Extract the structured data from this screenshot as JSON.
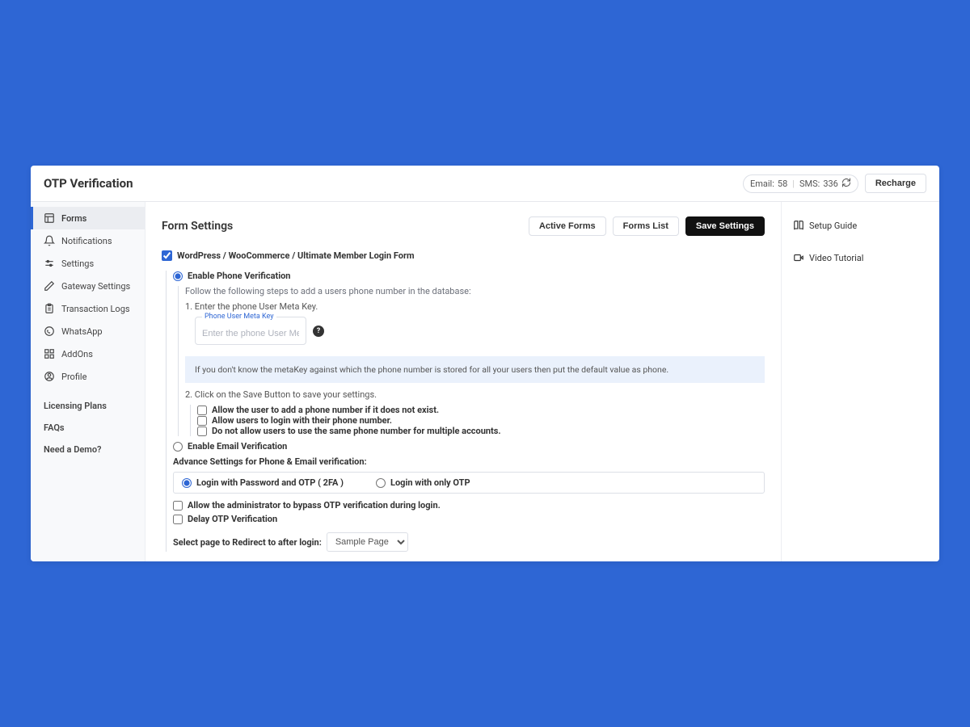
{
  "header": {
    "title": "OTP Verification",
    "quota_email_label": "Email:",
    "quota_email_value": "58",
    "quota_sms_label": "SMS:",
    "quota_sms_value": "336",
    "recharge_label": "Recharge"
  },
  "sidebar": {
    "items": [
      {
        "label": "Forms",
        "icon": "forms-icon",
        "active": true
      },
      {
        "label": "Notifications",
        "icon": "bell-icon"
      },
      {
        "label": "Settings",
        "icon": "sliders-icon"
      },
      {
        "label": "Gateway Settings",
        "icon": "pen-icon"
      },
      {
        "label": "Transaction Logs",
        "icon": "clipboard-icon"
      },
      {
        "label": "WhatsApp",
        "icon": "whatsapp-icon"
      },
      {
        "label": "AddOns",
        "icon": "grid-icon"
      },
      {
        "label": "Profile",
        "icon": "user-icon"
      }
    ],
    "extras": [
      {
        "label": "Licensing Plans"
      },
      {
        "label": "FAQs"
      },
      {
        "label": "Need a Demo?"
      }
    ]
  },
  "content": {
    "title": "Form Settings",
    "buttons": {
      "active_forms": "Active Forms",
      "forms_list": "Forms List",
      "save_settings": "Save Settings"
    },
    "form_name": "WordPress / WooCommerce / Ultimate Member Login Form",
    "enable_phone_label": "Enable Phone Verification",
    "phone_steps_intro": "Follow the following steps to add a users phone number in the database:",
    "step1": "1. Enter the phone User Meta Key.",
    "meta_key_label": "Phone User Meta Key",
    "meta_key_placeholder": "Enter the phone User Meta Ke",
    "info_banner": "If you don't know the metaKey against which the phone number is stored for all your users then put the default value as phone.",
    "step2": "2. Click on the Save Button to save your settings.",
    "allow_add_phone": "Allow the user to add a phone number if it does not exist.",
    "allow_login_phone": "Allow users to login with their phone number.",
    "disallow_same_phone": "Do not allow users to use the same phone number for multiple accounts.",
    "enable_email_label": "Enable Email Verification",
    "adv_title": "Advance Settings for Phone & Email verification:",
    "opt2fa": "Login with Password and OTP ( 2FA )",
    "opt_only_otp": "Login with only OTP",
    "admin_bypass": "Allow the administrator to bypass OTP verification during login.",
    "delay_otp": "Delay OTP Verification",
    "redirect_label": "Select page to Redirect to after login:",
    "redirect_selected": "Sample Page"
  },
  "rail": {
    "setup_guide": "Setup Guide",
    "video_tutorial": "Video Tutorial"
  }
}
